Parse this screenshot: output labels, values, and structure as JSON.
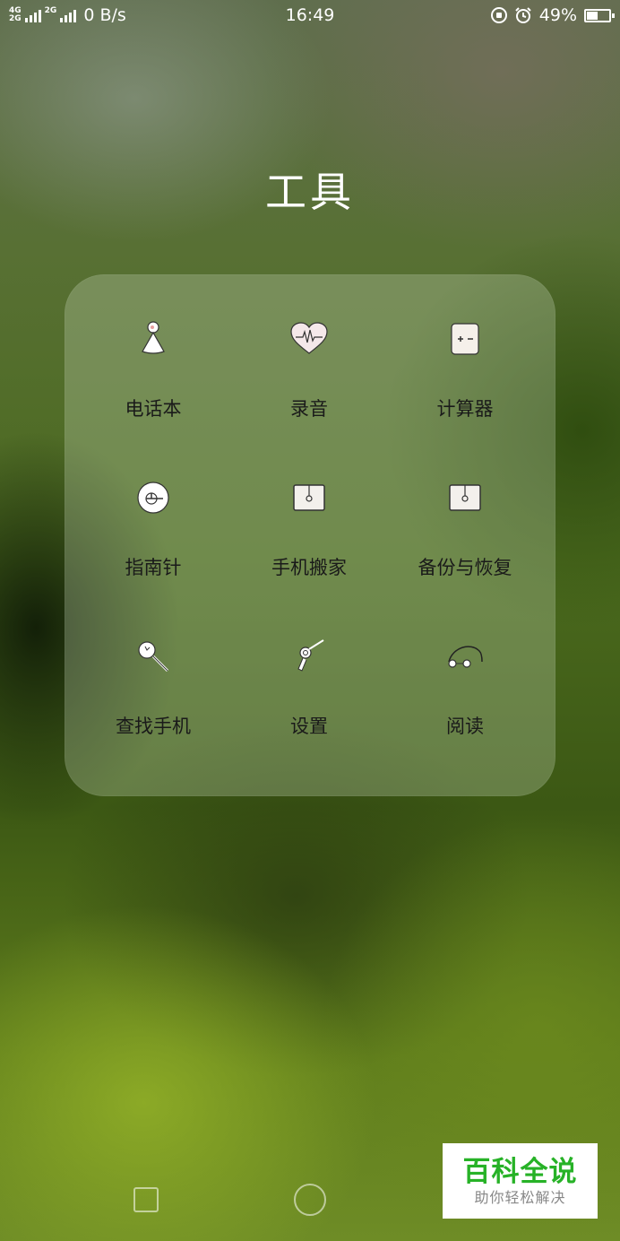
{
  "status_bar": {
    "network_top": "4G",
    "network_bottom": "2G",
    "network2": "2G",
    "data_rate": "0 B/s",
    "time": "16:49",
    "battery": "49%",
    "battery_level": 0.49,
    "icons": [
      "signal-icon",
      "rotation-lock-icon",
      "alarm-icon",
      "battery-icon"
    ]
  },
  "folder": {
    "title": "工具",
    "apps": [
      {
        "label": "电话本",
        "icon": "contacts-icon"
      },
      {
        "label": "录音",
        "icon": "recorder-icon"
      },
      {
        "label": "计算器",
        "icon": "calculator-icon"
      },
      {
        "label": "指南针",
        "icon": "compass-icon"
      },
      {
        "label": "手机搬家",
        "icon": "phone-clone-icon"
      },
      {
        "label": "备份与恢复",
        "icon": "backup-restore-icon"
      },
      {
        "label": "查找手机",
        "icon": "find-phone-icon"
      },
      {
        "label": "设置",
        "icon": "settings-icon"
      },
      {
        "label": "阅读",
        "icon": "reader-icon"
      }
    ]
  },
  "navigation": {
    "icons": [
      "recents-icon",
      "home-icon"
    ]
  },
  "watermark": {
    "title": "百科全说",
    "subtitle": "助你轻松解决",
    "color": "#27b227"
  }
}
